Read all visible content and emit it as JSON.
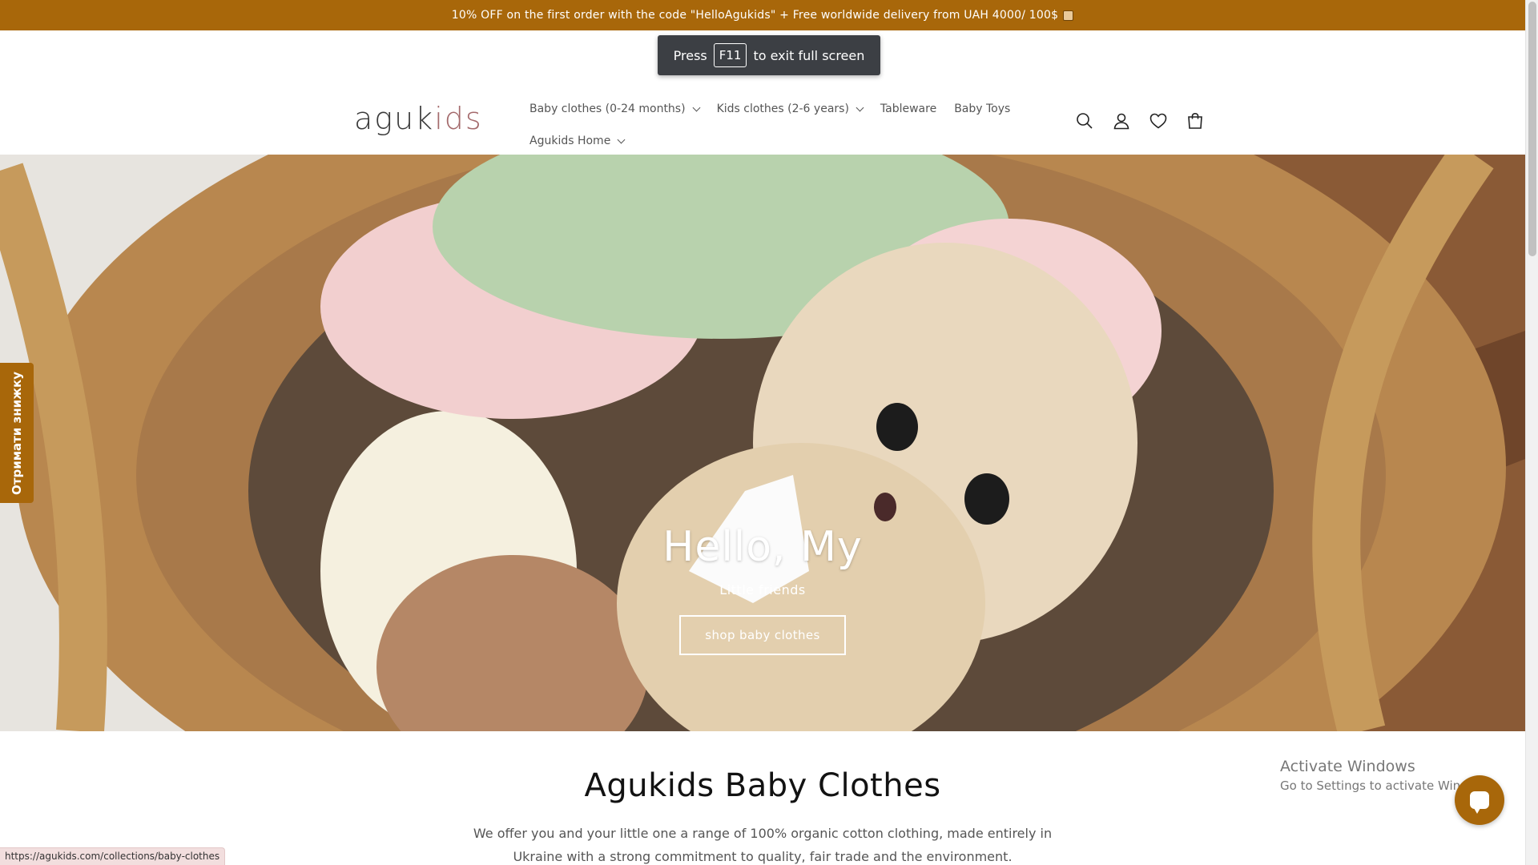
{
  "announcement": {
    "text": "10% OFF on the first order with the code \"HelloAgukids\" + Free worldwide delivery from UAH 4000/ 100$",
    "icon": "package-icon"
  },
  "fullscreen_toast": {
    "press": "Press",
    "key": "F11",
    "rest": "to exit full screen"
  },
  "header": {
    "logo": {
      "part1": "aguk",
      "part2": "ids"
    },
    "nav": [
      {
        "label": "Baby clothes (0-24 months)",
        "has_dropdown": true
      },
      {
        "label": "Kids clothes (2-6 years)",
        "has_dropdown": true
      },
      {
        "label": "Tableware",
        "has_dropdown": false
      },
      {
        "label": "Baby Toys",
        "has_dropdown": false
      },
      {
        "label": "Agukids Home",
        "has_dropdown": true
      }
    ],
    "icons": [
      "search-icon",
      "account-icon",
      "wishlist-heart-icon",
      "cart-icon"
    ]
  },
  "side_tab": {
    "label": "Отримати знижку"
  },
  "hero": {
    "title": "Hello, My",
    "subtitle": "Little friends",
    "button": "shop baby clothes"
  },
  "collection": {
    "title": "Agukids Baby Clothes",
    "description": "We offer you and your little one a range of 100% organic cotton clothing, made entirely in Ukraine with a strong commitment to quality, fair trade and the environment."
  },
  "activate_windows": {
    "line1": "Activate Windows",
    "line2": "Go to Settings to activate Windows."
  },
  "status_bar": {
    "url": "https://agukids.com/collections/baby-clothes"
  },
  "colors": {
    "brand": "#a8670a",
    "text": "#121212"
  }
}
